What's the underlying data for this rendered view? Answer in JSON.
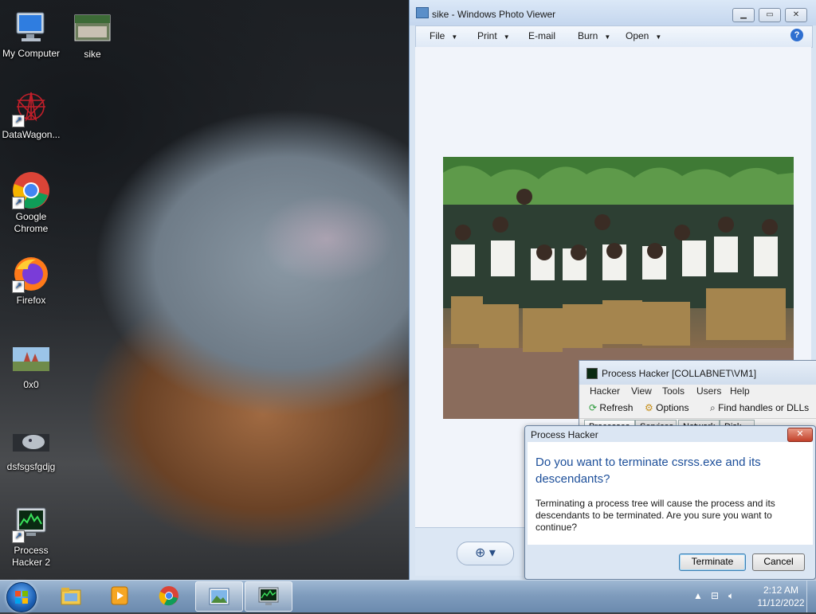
{
  "desktop": {
    "icons": [
      {
        "label": "My Computer"
      },
      {
        "label": "sike"
      },
      {
        "label": "DataWagon..."
      },
      {
        "label": "Google Chrome"
      },
      {
        "label": "Firefox"
      },
      {
        "label": "0x0"
      },
      {
        "label": "dsfsgsfgdjg"
      },
      {
        "label": "Process Hacker 2"
      }
    ]
  },
  "photo_viewer": {
    "title": "sike - Windows Photo Viewer",
    "menu": [
      "File",
      "Print",
      "E-mail",
      "Burn",
      "Open"
    ],
    "help_icon": "help-icon",
    "zoom_icon": "zoom-icon"
  },
  "process_hacker_main": {
    "title": "Process Hacker [COLLABNET\\VM1]",
    "menu": [
      "Hacker",
      "View",
      "Tools",
      "Users",
      "Help"
    ],
    "toolbar": {
      "refresh": "Refresh",
      "options": "Options",
      "find": "Find handles or DLLs"
    },
    "tabs": [
      "Processes",
      "Services",
      "Network",
      "Disk"
    ]
  },
  "dialog": {
    "title": "Process Hacker",
    "heading": "Do you want to terminate csrss.exe and its descendants?",
    "message": "Terminating a process tree will cause the process and its descendants to be terminated. Are you sure you want to continue?",
    "terminate_label": "Terminate",
    "cancel_label": "Cancel",
    "close_glyph": "✕"
  },
  "taskbar": {
    "pinned": [
      "windows-explorer",
      "media-player",
      "google-chrome",
      "photo-viewer",
      "process-hacker"
    ],
    "clock_time": "2:12 AM",
    "clock_date": "11/12/2022"
  },
  "colors": {
    "dialog_heading": "#1d4f9a",
    "taskbar": "#7f9cbd",
    "close_button": "#c2412a"
  }
}
